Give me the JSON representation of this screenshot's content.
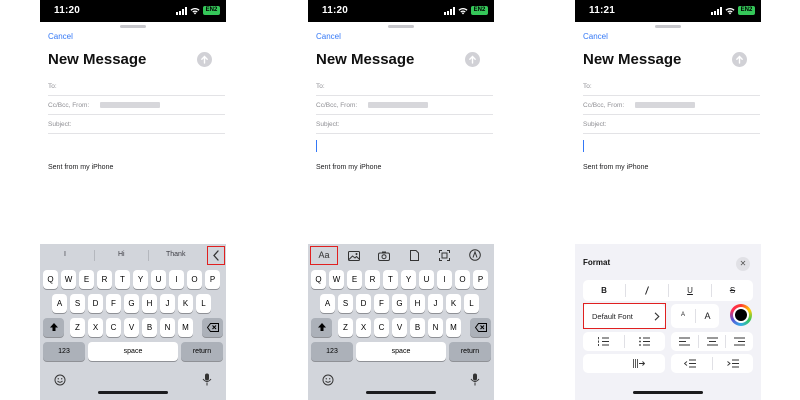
{
  "status": {
    "time1": "11:20",
    "time2": "11:20",
    "time3": "11:21",
    "battery": "EN2"
  },
  "compose": {
    "cancel": "Cancel",
    "title": "New Message",
    "to_label": "To:",
    "cc_label": "Cc/Bcc, From:",
    "subject_label": "Subject:",
    "signature": "Sent from my iPhone"
  },
  "suggestions": [
    "I",
    "Hi",
    "Thank"
  ],
  "keyboard": {
    "row1": [
      "Q",
      "W",
      "E",
      "R",
      "T",
      "Y",
      "U",
      "I",
      "O",
      "P"
    ],
    "row2": [
      "A",
      "S",
      "D",
      "F",
      "G",
      "H",
      "J",
      "K",
      "L"
    ],
    "row3": [
      "Z",
      "X",
      "C",
      "V",
      "B",
      "N",
      "M"
    ],
    "numbers": "123",
    "space": "space",
    "return": "return"
  },
  "toolbar": {
    "format_label": "Aa"
  },
  "format": {
    "title": "Format",
    "close": "✕",
    "bold": "B",
    "underline": "U",
    "strike": "S",
    "default_font": "Default Font",
    "small_a": "A",
    "big_a": "A"
  },
  "colors": {
    "accent": "#3478f6",
    "highlight": "#e02020",
    "keyboard_bg": "#d2d5db"
  },
  "icons": [
    "send-arrow-icon",
    "chevron-left-icon",
    "image-icon",
    "camera-icon",
    "document-icon",
    "scan-icon",
    "pen-icon",
    "emoji-icon",
    "microphone-icon",
    "backspace-icon",
    "shift-icon",
    "chevron-right-icon",
    "color-wheel-icon"
  ]
}
